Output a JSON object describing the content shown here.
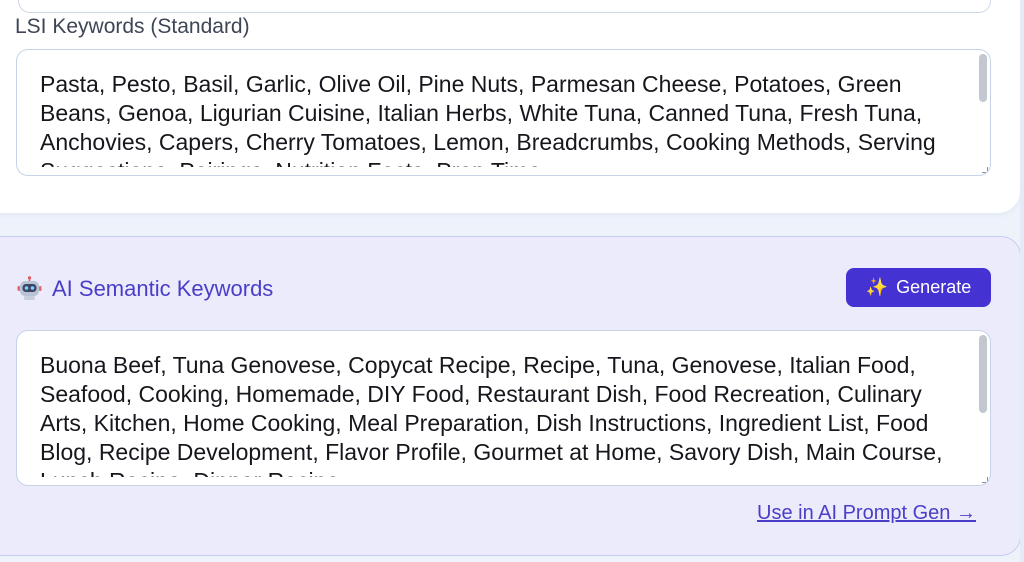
{
  "lsi": {
    "label": "LSI Keywords (Standard)",
    "text": "Pasta, Pesto, Basil, Garlic, Olive Oil, Pine Nuts, Parmesan Cheese, Potatoes, Green Beans, Genoa, Ligurian Cuisine, Italian Herbs, White Tuna, Canned Tuna, Fresh Tuna, Anchovies, Capers, Cherry Tomatoes, Lemon, Breadcrumbs, Cooking Methods, Serving Suggestions, Pairings, Nutrition Facts, Prep Time"
  },
  "ai": {
    "icon": "robot-icon",
    "title": "AI Semantic Keywords",
    "generate_label": "Generate",
    "generate_icon": "sparkles-icon",
    "text": "Buona Beef, Tuna Genovese, Copycat Recipe, Recipe, Tuna, Genovese, Italian Food, Seafood, Cooking, Homemade, DIY Food, Restaurant Dish, Food Recreation, Culinary Arts, Kitchen, Home Cooking, Meal Preparation, Dish Instructions, Ingredient List, Food Blog, Recipe Development, Flavor Profile, Gourmet at Home, Savory Dish, Main Course, Lunch Recipe, Dinner Recipe",
    "link_label": "Use in AI Prompt Gen →"
  },
  "colors": {
    "accent": "#4532d3",
    "ai_card_bg": "#ecebfb",
    "page_bg": "#eef3fb"
  }
}
